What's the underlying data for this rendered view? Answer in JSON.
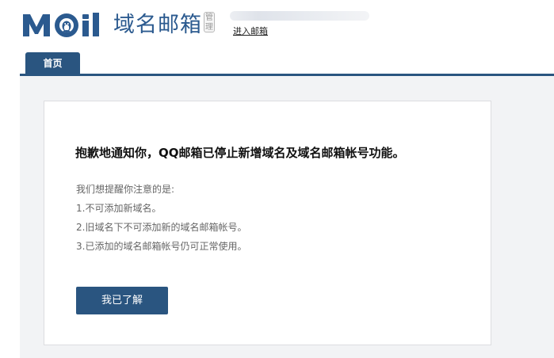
{
  "header": {
    "logo_text": "MOil",
    "product_name": "域名邮箱",
    "manage_stamp": [
      "管",
      "理"
    ],
    "account_name_blurred": "",
    "enter_mail_link": "进入邮箱"
  },
  "tabs": [
    {
      "label": "首页",
      "active": true
    }
  ],
  "notice": {
    "title": "抱歉地通知你，QQ邮箱已停止新增域名及域名邮箱帐号功能。",
    "intro": "我们想提醒你注意的是:",
    "items": [
      "1.不可添加新域名。",
      "2.旧域名下不可添加新的域名邮箱帐号。",
      "3.已添加的域名邮箱帐号仍可正常使用。"
    ]
  },
  "actions": {
    "acknowledge_label": "我已了解"
  },
  "colors": {
    "brand": "#2a5580",
    "logo": "#2b5a8f",
    "page_background": "#f2f3f5"
  },
  "icons": {
    "logo_mark": "qq-penguin-icon"
  }
}
